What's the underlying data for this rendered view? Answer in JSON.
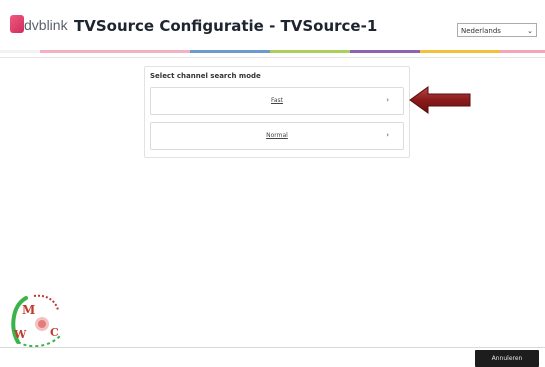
{
  "header": {
    "logo_text": "dvblink",
    "title": "TVSource Configuratie - TVSource-1",
    "language_select": {
      "value": "Nederlands"
    }
  },
  "panel": {
    "title": "Select channel search mode",
    "options": [
      {
        "label": "Fast"
      },
      {
        "label": "Normal"
      }
    ]
  },
  "footer": {
    "cancel_label": "Annuleren"
  },
  "watermark": {
    "letters": [
      "M",
      "W",
      "C"
    ]
  },
  "colors": {
    "stripe": [
      "#f2b2c4",
      "#6b9ad1",
      "#aacf5a",
      "#8c62b3",
      "#f4c03b",
      "#f7a4b8"
    ],
    "arrow": "#8b1a1a",
    "cancel_bg": "#1d1d1d"
  }
}
